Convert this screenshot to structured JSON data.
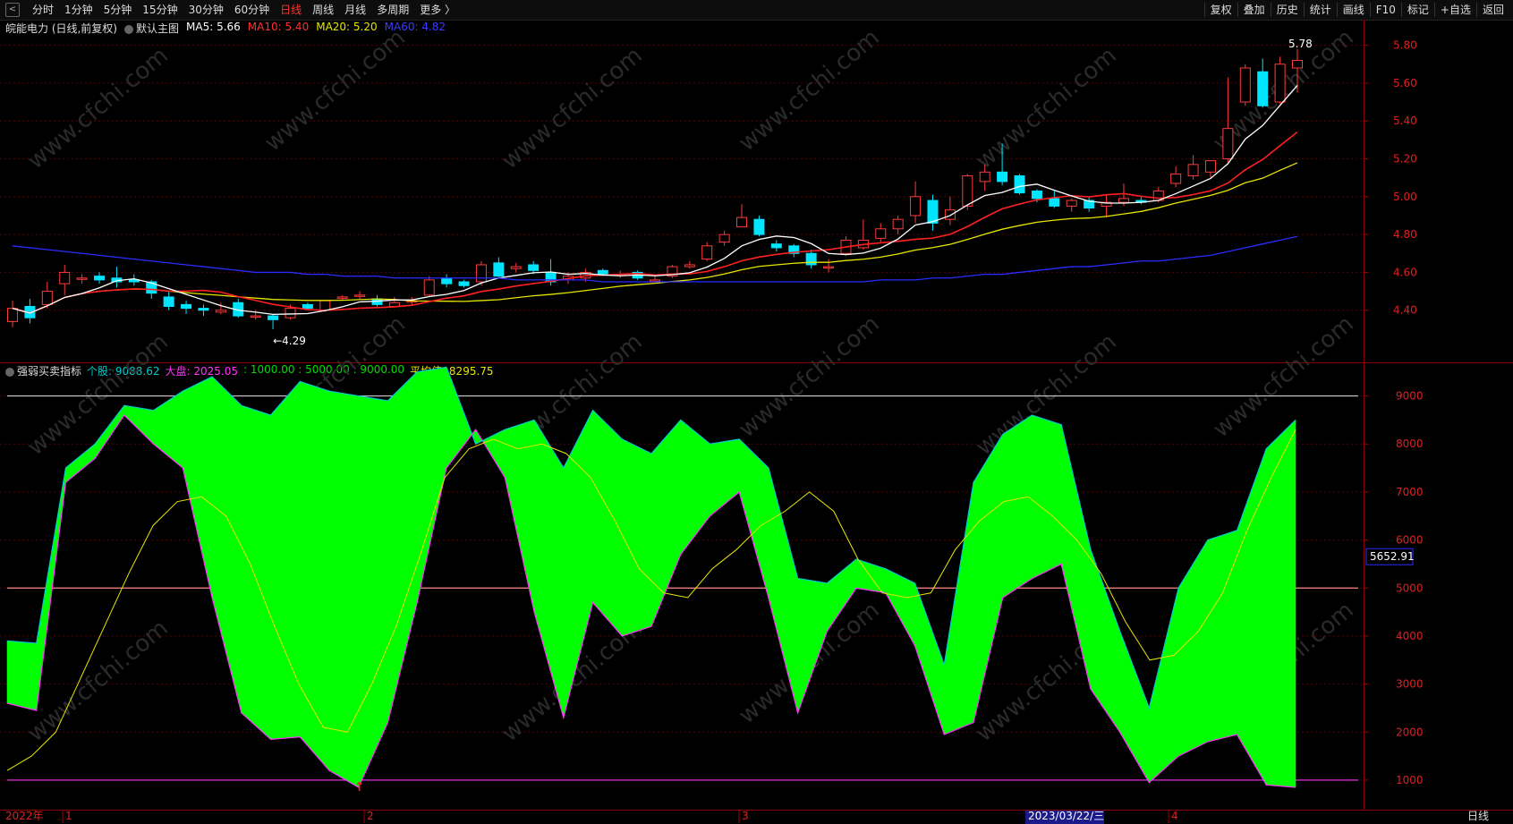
{
  "toolbar": {
    "back": "<",
    "periods": [
      "分时",
      "1分钟",
      "5分钟",
      "15分钟",
      "30分钟",
      "60分钟",
      "日线",
      "周线",
      "月线",
      "多周期",
      "更多 〉"
    ],
    "active_period": "日线",
    "actions": [
      "复权",
      "叠加",
      "历史",
      "统计",
      "画线",
      "F10",
      "标记",
      "+自选",
      "返回"
    ]
  },
  "main_info": {
    "stock": "皖能电力 (日线,前复权)",
    "template": "默认主图",
    "ma5": "MA5: 5.66",
    "ma10": "MA10: 5.40",
    "ma20": "MA20: 5.20",
    "ma60": "MA60: 4.82"
  },
  "indicator_info": {
    "name": "强弱买卖指标",
    "stock": "个股: 9088.62",
    "market": "大盘: 2025.05",
    "levels": ": 1000.00 : 5000.00 : 9000.00",
    "avg": "平均值: 8295.75"
  },
  "colors": {
    "ma5": "#ffffff",
    "ma10": "#ff2020",
    "ma20": "#e6e600",
    "ma60": "#2b2bff",
    "up": "#ff3b3b",
    "down": "#00e5ff",
    "stock_fill": "#ff0000",
    "market_fill": "#00ff00"
  },
  "price_axis": [
    "5.80",
    "5.60",
    "5.40",
    "5.20",
    "5.00",
    "4.80",
    "4.60",
    "4.40"
  ],
  "indicator_axis": [
    "9000",
    "8000",
    "7000",
    "6000",
    "5000",
    "4000",
    "3000",
    "2000",
    "1000"
  ],
  "cursor_value": "5652.91",
  "high_label": "5.78",
  "low_label": "4.29",
  "date_axis": {
    "year": "2022年",
    "m1": "1",
    "m2": "2",
    "m3": "3",
    "cursor_date": "2023/03/22/三",
    "m4": "4"
  },
  "watermark": "www.cfchi.com",
  "period_label": "日线",
  "chart_data": [
    {
      "type": "candlestick",
      "title": "皖能电力 (日线,前复权)",
      "ylim": [
        4.29,
        5.85
      ],
      "candles": [
        [
          4.34,
          4.41,
          4.45,
          4.31
        ],
        [
          4.42,
          4.36,
          4.46,
          4.33
        ],
        [
          4.43,
          4.5,
          4.55,
          4.41
        ],
        [
          4.54,
          4.6,
          4.64,
          4.48
        ],
        [
          4.57,
          4.57,
          4.59,
          4.54
        ],
        [
          4.58,
          4.56,
          4.6,
          4.54
        ],
        [
          4.57,
          4.55,
          4.63,
          4.52
        ],
        [
          4.56,
          4.55,
          4.59,
          4.53
        ],
        [
          4.55,
          4.49,
          4.56,
          4.46
        ],
        [
          4.47,
          4.42,
          4.5,
          4.4
        ],
        [
          4.43,
          4.41,
          4.45,
          4.38
        ],
        [
          4.41,
          4.4,
          4.43,
          4.37
        ],
        [
          4.39,
          4.4,
          4.44,
          4.38
        ],
        [
          4.44,
          4.37,
          4.46,
          4.36
        ],
        [
          4.37,
          4.37,
          4.4,
          4.35
        ],
        [
          4.37,
          4.35,
          4.38,
          4.3
        ],
        [
          4.36,
          4.41,
          4.43,
          4.35
        ],
        [
          4.43,
          4.41,
          4.44,
          4.4
        ],
        [
          4.4,
          4.45,
          4.45,
          4.39
        ],
        [
          4.47,
          4.47,
          4.48,
          4.45
        ],
        [
          4.48,
          4.48,
          4.5,
          4.46
        ],
        [
          4.46,
          4.43,
          4.48,
          4.42
        ],
        [
          4.42,
          4.44,
          4.47,
          4.42
        ],
        [
          4.45,
          4.45,
          4.47,
          4.43
        ],
        [
          4.48,
          4.56,
          4.58,
          4.47
        ],
        [
          4.57,
          4.54,
          4.59,
          4.52
        ],
        [
          4.55,
          4.53,
          4.56,
          4.52
        ],
        [
          4.55,
          4.64,
          4.66,
          4.53
        ],
        [
          4.65,
          4.58,
          4.68,
          4.57
        ],
        [
          4.62,
          4.63,
          4.65,
          4.6
        ],
        [
          4.64,
          4.61,
          4.66,
          4.59
        ],
        [
          4.6,
          4.55,
          4.67,
          4.53
        ],
        [
          4.56,
          4.58,
          4.6,
          4.54
        ],
        [
          4.57,
          4.6,
          4.62,
          4.55
        ],
        [
          4.61,
          4.59,
          4.62,
          4.58
        ],
        [
          4.59,
          4.59,
          4.61,
          4.57
        ],
        [
          4.6,
          4.57,
          4.61,
          4.56
        ],
        [
          4.56,
          4.56,
          4.58,
          4.55
        ],
        [
          4.58,
          4.63,
          4.64,
          4.57
        ],
        [
          4.63,
          4.64,
          4.66,
          4.62
        ],
        [
          4.67,
          4.74,
          4.76,
          4.66
        ],
        [
          4.76,
          4.8,
          4.82,
          4.74
        ],
        [
          4.84,
          4.89,
          4.96,
          4.84
        ],
        [
          4.88,
          4.8,
          4.9,
          4.79
        ],
        [
          4.75,
          4.73,
          4.77,
          4.71
        ],
        [
          4.74,
          4.7,
          4.75,
          4.68
        ],
        [
          4.7,
          4.64,
          4.72,
          4.62
        ],
        [
          4.63,
          4.63,
          4.67,
          4.6
        ],
        [
          4.7,
          4.77,
          4.79,
          4.69
        ],
        [
          4.73,
          4.77,
          4.88,
          4.72
        ],
        [
          4.78,
          4.83,
          4.86,
          4.76
        ],
        [
          4.83,
          4.88,
          4.9,
          4.8
        ],
        [
          4.9,
          5.0,
          5.08,
          4.86
        ],
        [
          4.98,
          4.86,
          5.01,
          4.82
        ],
        [
          4.88,
          4.93,
          5.0,
          4.85
        ],
        [
          4.95,
          5.11,
          5.12,
          4.93
        ],
        [
          5.08,
          5.13,
          5.17,
          5.03
        ],
        [
          5.13,
          5.08,
          5.28,
          5.06
        ],
        [
          5.11,
          5.02,
          5.12,
          5.01
        ],
        [
          5.03,
          4.99,
          5.04,
          4.97
        ],
        [
          4.99,
          4.95,
          5.03,
          4.94
        ],
        [
          4.95,
          4.98,
          4.99,
          4.92
        ],
        [
          4.98,
          4.94,
          5.0,
          4.92
        ],
        [
          4.95,
          4.97,
          5.01,
          4.89
        ],
        [
          4.97,
          4.99,
          5.07,
          4.95
        ],
        [
          4.98,
          4.97,
          5.0,
          4.96
        ],
        [
          4.98,
          5.03,
          5.05,
          4.97
        ],
        [
          5.07,
          5.12,
          5.16,
          5.05
        ],
        [
          5.11,
          5.17,
          5.22,
          5.09
        ],
        [
          5.13,
          5.19,
          5.19,
          5.1
        ],
        [
          5.2,
          5.36,
          5.63,
          5.18
        ],
        [
          5.5,
          5.68,
          5.7,
          5.48
        ],
        [
          5.66,
          5.48,
          5.73,
          5.47
        ],
        [
          5.5,
          5.7,
          5.74,
          5.49
        ],
        [
          5.68,
          5.72,
          5.78,
          5.55
        ]
      ]
    },
    {
      "type": "area",
      "title": "强弱买卖指标",
      "ylim": [
        850,
        9700
      ],
      "series": [
        {
          "name": "个股",
          "values": [
            3900,
            3850,
            7500,
            8000,
            8800,
            8700,
            9100,
            9400,
            8800,
            8600,
            9300,
            9100,
            9000,
            8900,
            9500,
            9600,
            8000,
            8300,
            8500,
            7500,
            8700,
            8100,
            7800,
            8500,
            8000,
            8100,
            7500,
            5200,
            5100,
            5600,
            5400,
            5100,
            3400,
            7200,
            8200,
            8600,
            8400,
            5800,
            4100,
            2500,
            5000,
            6000,
            6200,
            7900,
            8500
          ]
        },
        {
          "name": "大盘",
          "values": [
            2600,
            2450,
            7200,
            7700,
            8600,
            8000,
            7500,
            4800,
            2400,
            1850,
            1900,
            1200,
            850,
            2200,
            4700,
            7500,
            8300,
            7300,
            4500,
            2300,
            4700,
            4000,
            4200,
            5700,
            6500,
            7000,
            4800,
            2400,
            4100,
            5000,
            4900,
            3800,
            1950,
            2200,
            4800,
            5200,
            5500,
            2900,
            2000,
            950,
            1500,
            1800,
            1950,
            900,
            850
          ]
        },
        {
          "name": "平均值",
          "values": [
            1200,
            1500,
            2000,
            3100,
            4200,
            5300,
            6300,
            6800,
            6900,
            6500,
            5500,
            4200,
            3000,
            2100,
            2000,
            3000,
            4200,
            5700,
            7300,
            7900,
            8100,
            7900,
            8000,
            7800,
            7300,
            6400,
            5400,
            4900,
            4800,
            5400,
            5800,
            6300,
            6600,
            7000,
            6600,
            5600,
            4900,
            4800,
            4900,
            5800,
            6400,
            6800,
            6900,
            6500,
            6000,
            5300,
            4300,
            3500,
            3600,
            4100,
            4900,
            6200,
            7300,
            8300
          ],
          "x_step": "per-bar"
        }
      ],
      "reference_lines": [
        1000,
        5000,
        9000
      ]
    }
  ]
}
